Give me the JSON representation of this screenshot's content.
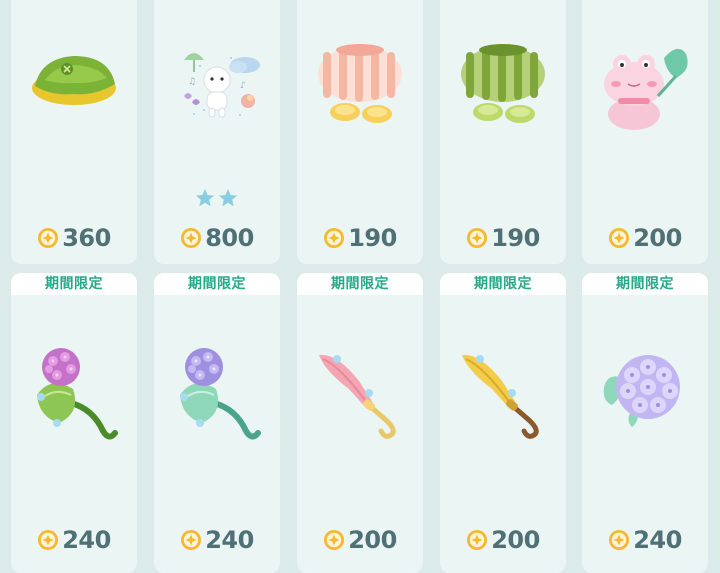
{
  "shop": {
    "items": [
      {
        "name": "green-leaf-hat",
        "price": "360",
        "limited": false
      },
      {
        "name": "rainy-day-stickers",
        "price": "800",
        "limited": false,
        "stars": 2
      },
      {
        "name": "pink-striped-pants-boots",
        "price": "190",
        "limited": false
      },
      {
        "name": "green-striped-pants-boots",
        "price": "190",
        "limited": false
      },
      {
        "name": "pink-frog-plush",
        "price": "200",
        "limited": false
      },
      {
        "name": "hydrangea-leaf-pink",
        "price": "240",
        "limited": true,
        "limited_label": "期間限定"
      },
      {
        "name": "hydrangea-leaf-mint",
        "price": "240",
        "limited": true,
        "limited_label": "期間限定"
      },
      {
        "name": "pink-umbrella",
        "price": "200",
        "limited": true,
        "limited_label": "期間限定"
      },
      {
        "name": "yellow-umbrella",
        "price": "200",
        "limited": true,
        "limited_label": "期間限定"
      },
      {
        "name": "purple-hydrangea",
        "price": "240",
        "limited": true,
        "limited_label": "期間限定"
      }
    ]
  },
  "colors": {
    "background": "#dcebea",
    "card": "#eaf5f4",
    "limited_text": "#27a889",
    "price_text": "#4f7074",
    "coin": "#f6b733"
  },
  "icons": {
    "coin": "coin-icon",
    "star": "star-icon"
  }
}
